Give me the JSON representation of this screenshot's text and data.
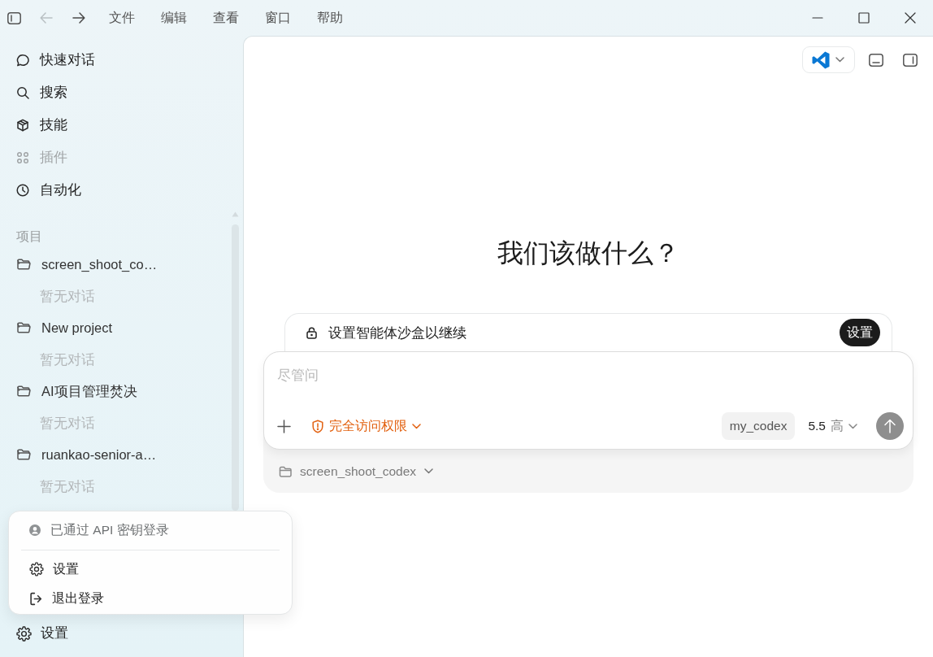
{
  "titlebar": {
    "nav_buttons": [
      {
        "kind": "back",
        "disabled": true
      },
      {
        "kind": "forward",
        "disabled": false
      }
    ],
    "menus": [
      "文件",
      "编辑",
      "查看",
      "窗口",
      "帮助"
    ]
  },
  "sidebar": {
    "nav_items": [
      {
        "label": "快速对话",
        "disabled": false
      },
      {
        "label": "搜索",
        "disabled": false
      },
      {
        "label": "技能",
        "disabled": false
      },
      {
        "label": "插件",
        "disabled": true
      },
      {
        "label": "自动化",
        "disabled": false
      }
    ],
    "projects_heading": "项目",
    "projects": [
      {
        "name": "screen_shoot_co…",
        "note": "暂无对话"
      },
      {
        "name": "New project",
        "note": "暂无对话"
      },
      {
        "name": "AI项目管理焚决",
        "note": "暂无对话"
      },
      {
        "name": "ruankao-senior-a…",
        "note": "暂无对话"
      }
    ],
    "settings_label": "设置"
  },
  "account_menu": {
    "status": "已通过 API 密钥登录",
    "items": [
      {
        "kind": "settings",
        "label": "设置"
      },
      {
        "kind": "logout",
        "label": "退出登录"
      }
    ]
  },
  "main": {
    "heading": "我们该做什么？",
    "sandbox_banner": {
      "text": "设置智能体沙盒以继续",
      "button": "设置"
    },
    "composer": {
      "placeholder": "尽管问",
      "access_mode": "完全访问权限",
      "profile": "my_codex",
      "model": "5.5",
      "effort": "高",
      "send_disabled": true
    },
    "project_picker": "screen_shoot_codex"
  }
}
